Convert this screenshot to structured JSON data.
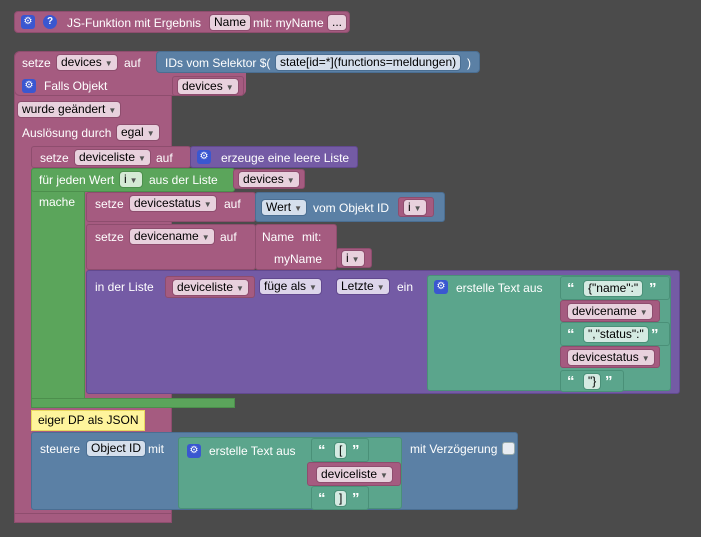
{
  "function_header": {
    "label": "JS-Funktion mit Ergebnis",
    "name_field": "Name",
    "param_label": "mit: myName",
    "more_button": "..."
  },
  "set_devices": {
    "label": "setze",
    "var": "devices",
    "to": "auf",
    "selector_label": "IDs vom Selektor $(",
    "selector_value": "state[id=*](functions=meldungen)",
    "selector_close": ")"
  },
  "trigger": {
    "if_object": "Falls Objekt",
    "object_var": "devices",
    "changed": "wurde geändert",
    "triggered_by_label": "Auslösung durch",
    "triggered_by_value": "egal"
  },
  "set_list": {
    "label": "setze",
    "var": "deviceliste",
    "to": "auf",
    "value": "erzeuge eine leere Liste"
  },
  "for_each": {
    "label": "für jeden Wert",
    "var": "i",
    "from_list": "aus der Liste",
    "list_var": "devices",
    "do": "mache"
  },
  "set_status": {
    "label": "setze",
    "var": "devicestatus",
    "to": "auf",
    "value_field": "Wert",
    "from_object": "vom Objekt ID",
    "id_var": "i"
  },
  "set_name": {
    "label": "setze",
    "var": "devicename",
    "to": "auf",
    "func_name": "Name",
    "func_with": "mit:",
    "param": "myName",
    "param_var": "i"
  },
  "list_insert": {
    "in_list": "in der Liste",
    "list_var": "deviceliste",
    "mode": "füge als",
    "position": "Letzte",
    "as": "ein",
    "create_text": "erstelle Text aus",
    "parts": [
      "{\"name\":\"",
      "devicename",
      "\",\"status\":\"",
      "devicestatus",
      "\"}"
    ]
  },
  "comment": "eiger DP als JSON",
  "control": {
    "label": "steuere",
    "object_field": "Object ID",
    "with": "mit",
    "create_text": "erstelle Text aus",
    "parts": [
      "[",
      "deviceliste",
      "]"
    ],
    "delay": "mit Verzögerung"
  },
  "icons": {
    "gear": "⚙",
    "help": "?",
    "dropdown": "▼",
    "quote_open": "“",
    "quote_close": "”"
  }
}
